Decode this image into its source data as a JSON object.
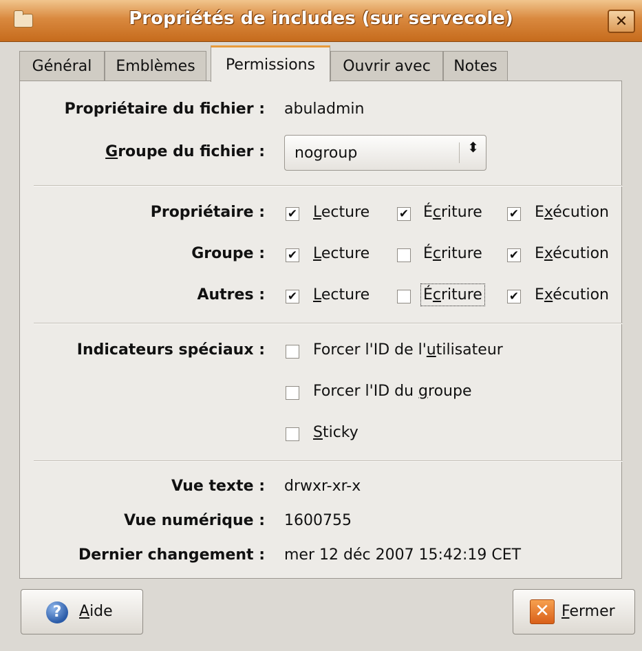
{
  "window": {
    "title": "Propriétés de includes (sur servecole)",
    "close_glyph": "✕"
  },
  "tabs": [
    {
      "label": "Général"
    },
    {
      "label": "Emblèmes"
    },
    {
      "label": "Permissions"
    },
    {
      "label": "Ouvrir avec"
    },
    {
      "label": "Notes"
    }
  ],
  "owner": {
    "label": "Propriétaire du fichier :",
    "value": "abuladmin"
  },
  "group": {
    "label_rest": "roupe du fichier :",
    "label_mnemonic": "G",
    "selected": "nogroup",
    "arrow_glyph": "⬍"
  },
  "permissions": {
    "rows": [
      {
        "label": "Propriétaire :",
        "read": true,
        "write": true,
        "exec": true
      },
      {
        "label": "Groupe :",
        "read": true,
        "write": false,
        "exec": true
      },
      {
        "label": "Autres :",
        "read": true,
        "write": false,
        "exec": true
      }
    ],
    "read_label": {
      "pre": "",
      "mn": "L",
      "post": "ecture"
    },
    "write_label": {
      "pre": "É",
      "mn": "c",
      "post": "riture"
    },
    "exec_label": {
      "pre": "E",
      "mn": "x",
      "post": "écution"
    },
    "check_glyph": "✔"
  },
  "special": {
    "label": "Indicateurs spéciaux :",
    "setuid": {
      "pre": "Forcer l'ID de l'",
      "mn": "u",
      "post": "tilisateur"
    },
    "setgid": {
      "pre": "Forcer l'ID du ",
      "mn": "g",
      "post": "roupe"
    },
    "sticky": {
      "pre": "",
      "mn": "S",
      "post": "ticky"
    }
  },
  "text_view": {
    "label": "Vue texte :",
    "value": "drwxr-xr-x"
  },
  "numeric_view": {
    "label": "Vue numérique :",
    "value": "1600755"
  },
  "last_changed": {
    "label": "Dernier changement :",
    "value": "mer 12 déc 2007 15:42:19 CET"
  },
  "buttons": {
    "help": {
      "mn": "A",
      "post": "ide",
      "icon_glyph": "?"
    },
    "close": {
      "mn": "F",
      "post": "ermer",
      "icon_glyph": "✕"
    }
  },
  "colors": {
    "title_bar": "#d9893f",
    "active_tab_accent": "#e89a3a",
    "window_bg": "#dcd9d3",
    "panel_bg": "#edebe7"
  }
}
